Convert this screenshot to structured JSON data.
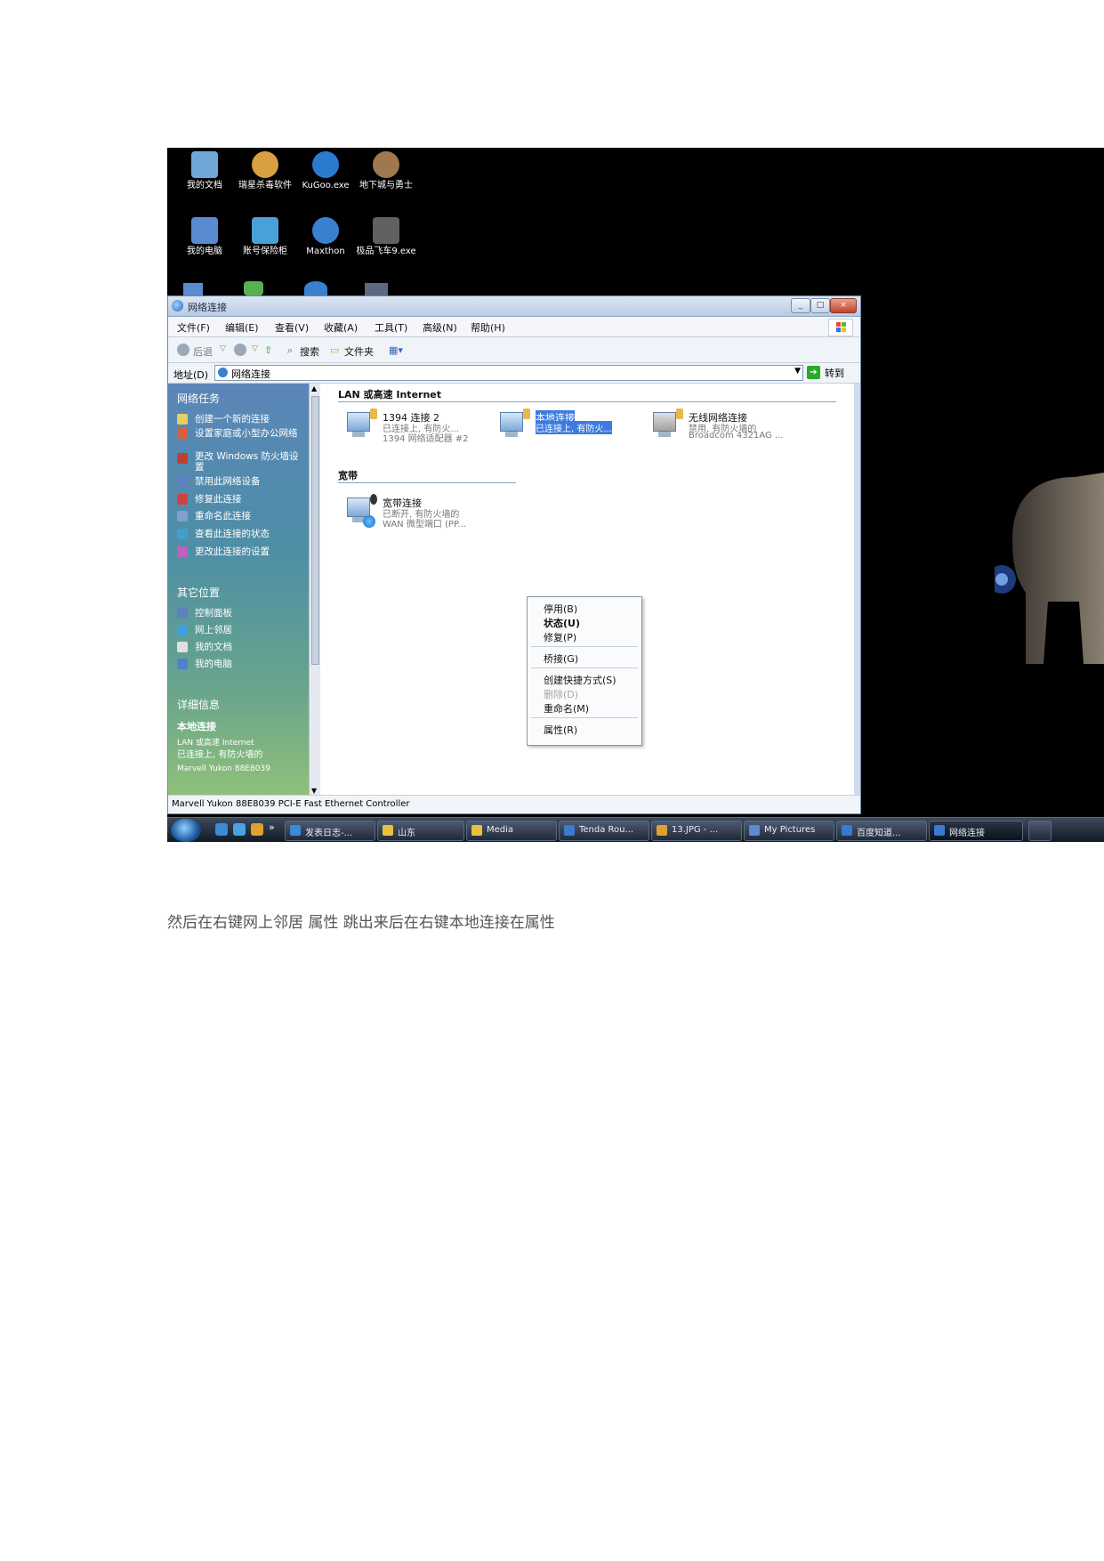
{
  "desktop": {
    "icons": [
      {
        "label": "我的文档",
        "color": "#6fa8d8"
      },
      {
        "label": "瑞星杀毒软件",
        "color": "#d8a040"
      },
      {
        "label": "KuGoo.exe",
        "color": "#2a7ad0"
      },
      {
        "label": "地下城与勇士",
        "color": "#a07850"
      },
      {
        "label": "我的电脑",
        "color": "#5a8ad0"
      },
      {
        "label": "账号保险柜",
        "color": "#4aa0d8"
      },
      {
        "label": "Maxthon",
        "color": "#3a80d0"
      },
      {
        "label": "极品飞车9.exe",
        "color": "#606060"
      }
    ]
  },
  "window": {
    "title": "网络连接",
    "controls": [
      "_",
      "□",
      "×"
    ],
    "menu": [
      "文件(F)",
      "编辑(E)",
      "查看(V)",
      "收藏(A)",
      "工具(T)",
      "高级(N)",
      "帮助(H)"
    ],
    "toolbar": {
      "back": "后退",
      "search": "搜索",
      "folders": "文件夹"
    },
    "address": {
      "label": "地址(D)",
      "value": "网络连接",
      "go": "转到"
    },
    "sidebar": {
      "tasks_title": "网络任务",
      "tasks": [
        {
          "label": "创建一个新的连接",
          "color": "#e8d060"
        },
        {
          "label": "设置家庭或小型办公网络",
          "color": "#d86040"
        },
        {
          "label": "更改 Windows 防火墙设置",
          "color": "#c04030"
        },
        {
          "label": "禁用此网络设备",
          "color": "#6080c0"
        },
        {
          "label": "修复此连接",
          "color": "#d04040"
        },
        {
          "label": "重命名此连接",
          "color": "#80a0d0"
        },
        {
          "label": "查看此连接的状态",
          "color": "#40a0d0"
        },
        {
          "label": "更改此连接的设置",
          "color": "#c060c0"
        }
      ],
      "other_title": "其它位置",
      "other": [
        {
          "label": "控制面板",
          "color": "#6080c0"
        },
        {
          "label": "网上邻居",
          "color": "#40a0e0"
        },
        {
          "label": "我的文档",
          "color": "#e0e0e0"
        },
        {
          "label": "我的电脑",
          "color": "#5080d0"
        }
      ],
      "details_title": "详细信息",
      "details_name": "本地连接",
      "details_lines": [
        "LAN 或高速 Internet",
        "已连接上, 有防火墙的",
        "Marvell Yukon 88E8039"
      ]
    },
    "groups": {
      "lan": "LAN 或高速 Internet",
      "broadband": "宽带"
    },
    "connections": [
      {
        "name": "1394 连接 2",
        "status": "已连接上, 有防火...",
        "device": "1394 网络适配器 #2"
      },
      {
        "name": "本地连接",
        "status": "已连接上, 有防火...",
        "device": ""
      },
      {
        "name": "无线网络连接",
        "status": "禁用, 有防火墙的",
        "device": "Broadcom 4321AG ..."
      },
      {
        "name": "宽带连接",
        "status": "已断开, 有防火墙的",
        "device": "WAN 微型端口 (PP..."
      }
    ],
    "context_menu": [
      {
        "label": "停用(B)",
        "bold": false,
        "disabled": false
      },
      {
        "label": "状态(U)",
        "bold": true,
        "disabled": false
      },
      {
        "label": "修复(P)",
        "bold": false,
        "disabled": false
      },
      {
        "label": "桥接(G)",
        "bold": false,
        "disabled": false
      },
      {
        "label": "创建快捷方式(S)",
        "bold": false,
        "disabled": false
      },
      {
        "label": "删除(D)",
        "bold": false,
        "disabled": true
      },
      {
        "label": "重命名(M)",
        "bold": false,
        "disabled": false
      },
      {
        "label": "属性(R)",
        "bold": false,
        "disabled": false
      }
    ],
    "status": "Marvell Yukon 88E8039 PCI-E Fast Ethernet Controller"
  },
  "taskbar": {
    "buttons": [
      {
        "label": "发表日志-...",
        "color": "#3a8ad8"
      },
      {
        "label": "山东",
        "color": "#e8c040"
      },
      {
        "label": "Media",
        "color": "#e8c040"
      },
      {
        "label": "Tenda Rou...",
        "color": "#3a7ad0"
      },
      {
        "label": "13.JPG - ...",
        "color": "#e0a030"
      },
      {
        "label": "My Pictures",
        "color": "#5a8ad0"
      },
      {
        "label": "百度知道...",
        "color": "#3a7ad0"
      },
      {
        "label": "网络连接",
        "color": "#3a7ad0"
      }
    ]
  },
  "caption": "然后在右键网上邻居 属性 跳出来后在右键本地连接在属性"
}
